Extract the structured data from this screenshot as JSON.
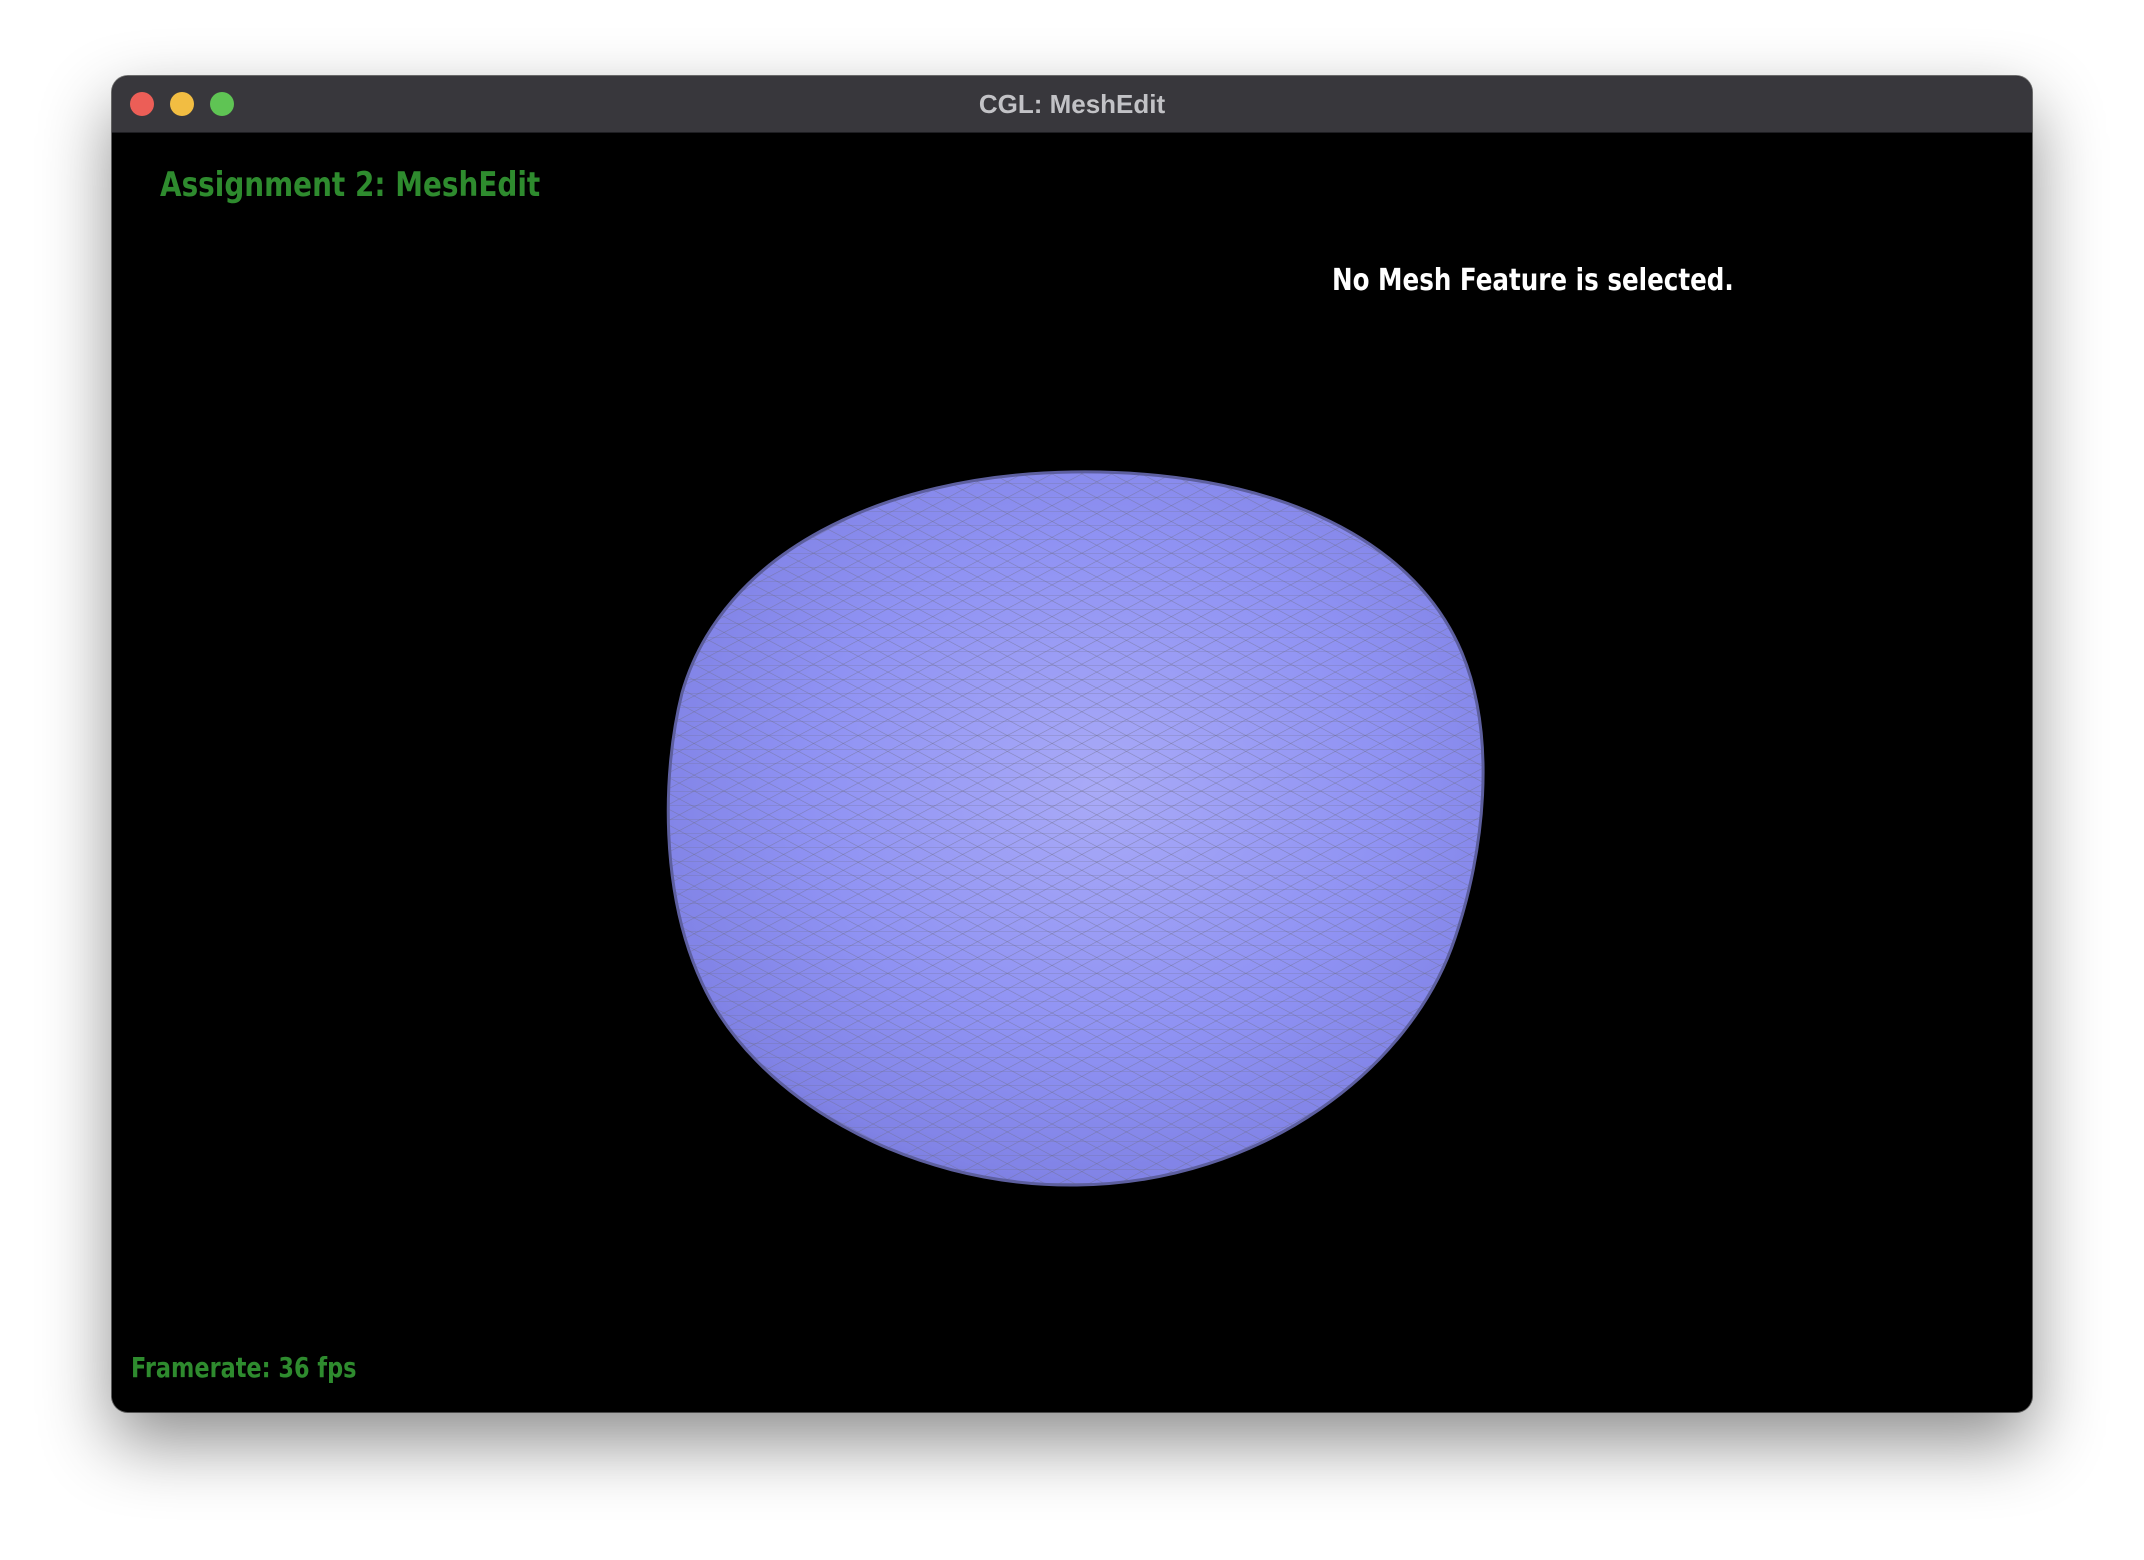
{
  "window": {
    "title": "CGL: MeshEdit",
    "controls": [
      "close",
      "minimize",
      "maximize"
    ]
  },
  "app": {
    "heading": "Assignment 2: MeshEdit",
    "selection_status": "No Mesh Feature is selected.",
    "framerate_label": "Framerate: 36 fps"
  },
  "viewport": {
    "background": "#000000",
    "object": "mesh-blob"
  },
  "colors": {
    "accent_green": "#2e8b2e",
    "status_text": "#ffffff",
    "mesh_fill": "#8c8ef5",
    "mesh_wire": "#7a7a88",
    "titlebar": "#38373c",
    "close": "#ec5e57",
    "minimize": "#f2bd42",
    "maximize": "#5fc454"
  }
}
